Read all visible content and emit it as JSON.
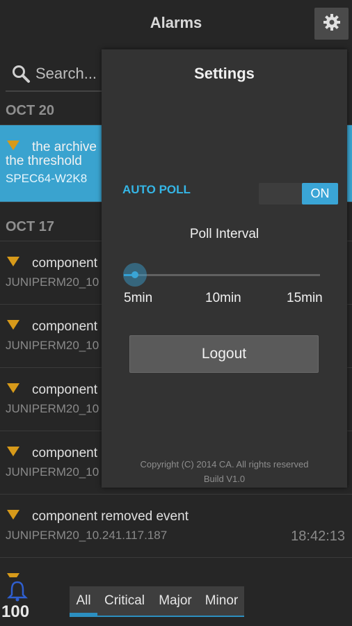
{
  "header": {
    "title": "Alarms",
    "settings_icon": "gear-icon"
  },
  "search": {
    "placeholder": "Search...",
    "icon": "search-icon"
  },
  "sections": [
    {
      "label": "OCT 20"
    },
    {
      "label": "OCT 17"
    }
  ],
  "alarms": [
    {
      "message_line1": "the archive",
      "message_line2": "the threshold",
      "host": "SPEC64-W2K8",
      "severity_color": "#d79a1a",
      "selected": true
    },
    {
      "message": "component",
      "host": "JUNIPERM20_10"
    },
    {
      "message": "component",
      "host": "JUNIPERM20_10"
    },
    {
      "message": "component",
      "host": "JUNIPERM20_10"
    },
    {
      "message": "component",
      "host": "JUNIPERM20_10"
    },
    {
      "message": "component removed event",
      "host": "JUNIPERM20_10.241.117.187",
      "time": "18:42:13"
    }
  ],
  "settings": {
    "title": "Settings",
    "auto_poll_label": "AUTO POLL",
    "auto_poll_state": "ON",
    "poll_interval_label": "Poll Interval",
    "poll_interval_options": [
      "5min",
      "10min",
      "15min"
    ],
    "poll_interval_selected": "5min",
    "logout_label": "Logout",
    "copyright": "Copyright (C) 2014 CA. All rights reserved",
    "build": "Build V1.0"
  },
  "footer": {
    "alarm_count": "100",
    "bell_icon": "bell-icon",
    "tabs": [
      {
        "label": "All",
        "active": true
      },
      {
        "label": "Critical"
      },
      {
        "label": "Major"
      },
      {
        "label": "Minor"
      }
    ]
  },
  "colors": {
    "accent": "#3aa5d6",
    "warning": "#d79a1a",
    "background": "#262626",
    "panel": "#333333"
  }
}
